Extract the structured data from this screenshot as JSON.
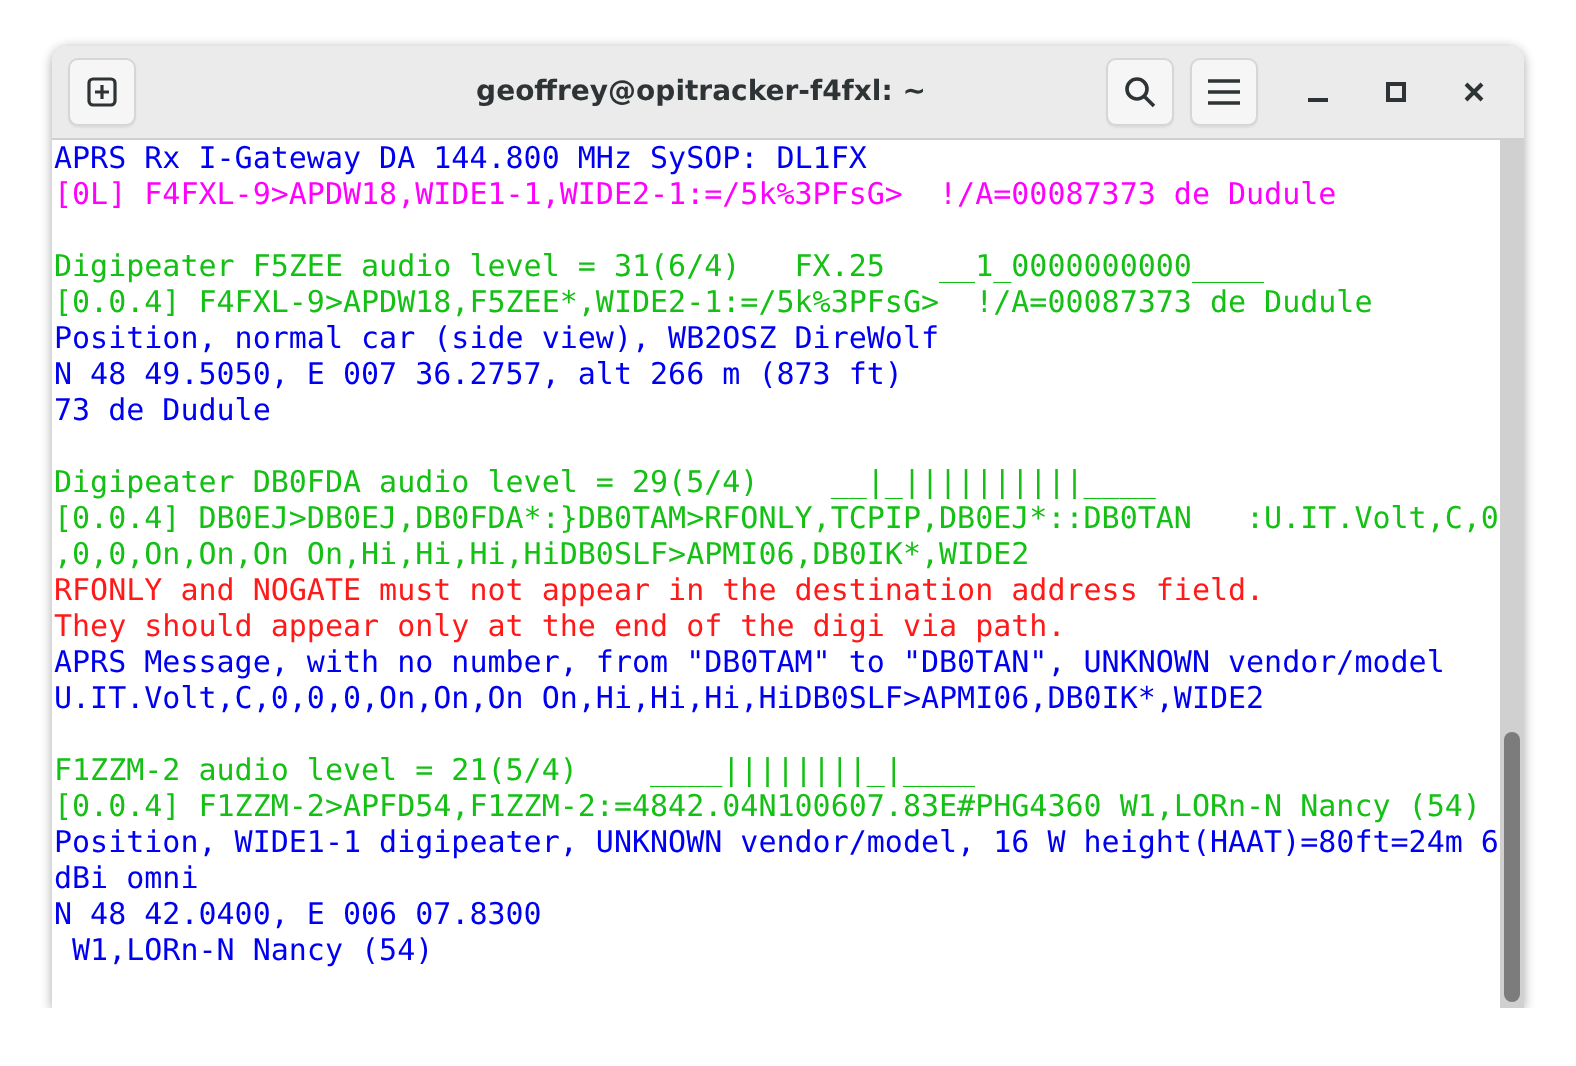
{
  "window": {
    "title": "geoffrey@opitracker-f4fxl: ~"
  },
  "terminal": {
    "lines": [
      {
        "kind": "info",
        "text": "APRS Rx I-Gateway DA 144.800 MHz SySOP: DL1FX"
      },
      {
        "kind": "packet",
        "text": "[0L] F4FXL-9>APDW18,WIDE1-1,WIDE2-1:=/5k%3PFsG>  !/A=00087373 de Dudule"
      },
      {
        "kind": "blank"
      },
      {
        "kind": "digi",
        "text": "Digipeater F5ZEE audio level = 31(6/4)   FX.25   __1_0000000000____"
      },
      {
        "kind": "digi",
        "text": "[0.0.4] F4FXL-9>APDW18,F5ZEE*,WIDE2-1:=/5k%3PFsG>  !/A=00087373 de Dudule"
      },
      {
        "kind": "info",
        "text": "Position, normal car (side view), WB2OSZ DireWolf"
      },
      {
        "kind": "info",
        "text": "N 48 49.5050, E 007 36.2757, alt 266 m (873 ft)"
      },
      {
        "kind": "info",
        "text": "73 de Dudule"
      },
      {
        "kind": "blank"
      },
      {
        "kind": "digi",
        "text": "Digipeater DB0FDA audio level = 29(5/4)    __|_||||||||||____"
      },
      {
        "kind": "digi",
        "text": "[0.0.4] DB0EJ>DB0EJ,DB0FDA*:}DB0TAM>RFONLY,TCPIP,DB0EJ*::DB0TAN   :U.IT.Volt,C,0"
      },
      {
        "kind": "digi",
        "text": ",0,0,On,On,On On,Hi,Hi,Hi,HiDB0SLF>APMI06,DB0IK*,WIDE2"
      },
      {
        "kind": "error",
        "text": "RFONLY and NOGATE must not appear in the destination address field."
      },
      {
        "kind": "error",
        "text": "They should appear only at the end of the digi via path."
      },
      {
        "kind": "info",
        "text": "APRS Message, with no number, from \"DB0TAM\" to \"DB0TAN\", UNKNOWN vendor/model"
      },
      {
        "kind": "info",
        "text": "U.IT.Volt,C,0,0,0,On,On,On On,Hi,Hi,Hi,HiDB0SLF>APMI06,DB0IK*,WIDE2"
      },
      {
        "kind": "blank"
      },
      {
        "kind": "digi",
        "text": "F1ZZM-2 audio level = 21(5/4)    ____||||||||_|____"
      },
      {
        "kind": "digi",
        "text": "[0.0.4] F1ZZM-2>APFD54,F1ZZM-2:=4842.04N100607.83E#PHG4360 W1,LORn-N Nancy (54)"
      },
      {
        "kind": "info",
        "text": "Position, WIDE1-1 digipeater, UNKNOWN vendor/model, 16 W height(HAAT)=80ft=24m 6"
      },
      {
        "kind": "info",
        "text": "dBi omni"
      },
      {
        "kind": "info",
        "text": "N 48 42.0400, E 006 07.8300"
      },
      {
        "kind": "info",
        "text": " W1,LORn-N Nancy (54)"
      }
    ]
  }
}
